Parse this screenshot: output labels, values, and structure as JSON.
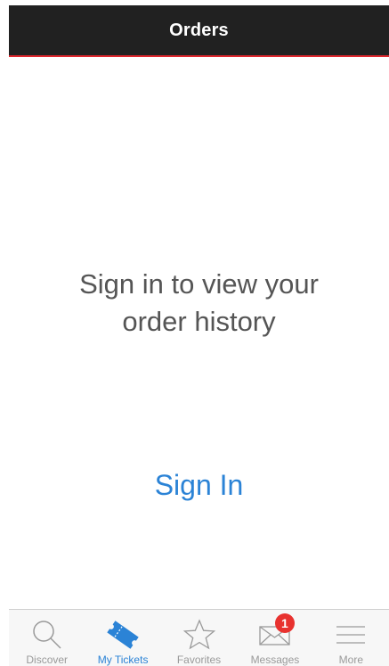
{
  "header": {
    "title": "Orders"
  },
  "main": {
    "message_line1": "Sign in to view your",
    "message_line2": "order history",
    "sign_in_label": "Sign In"
  },
  "tab_bar": {
    "tabs": [
      {
        "label": "Discover",
        "icon": "search-icon",
        "active": false
      },
      {
        "label": "My Tickets",
        "icon": "ticket-icon",
        "active": true
      },
      {
        "label": "Favorites",
        "icon": "star-icon",
        "active": false
      },
      {
        "label": "Messages",
        "icon": "envelope-icon",
        "active": false,
        "badge": "1"
      },
      {
        "label": "More",
        "icon": "menu-icon",
        "active": false
      }
    ]
  },
  "colors": {
    "nav_background": "#212121",
    "nav_accent": "#e0262d",
    "link_blue": "#2b83d6",
    "badge_red": "#e8322f"
  }
}
